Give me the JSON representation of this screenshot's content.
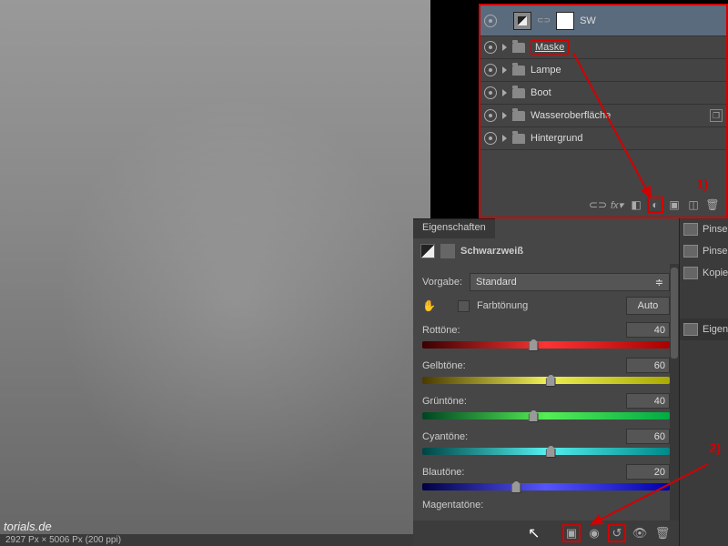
{
  "canvas": {
    "watermark": "torials.de",
    "status": "2927 Px × 5006 Px (200 ppi)"
  },
  "layers": {
    "items": [
      {
        "label": "SW",
        "type": "adjustment",
        "selected": true
      },
      {
        "label": "Maske",
        "type": "group",
        "highlighted": true
      },
      {
        "label": "Lampe",
        "type": "group"
      },
      {
        "label": "Boot",
        "type": "group"
      },
      {
        "label": "Wasseroberfläche",
        "type": "group"
      },
      {
        "label": "Hintergrund",
        "type": "group"
      }
    ],
    "callout": "1)"
  },
  "properties": {
    "tab": "Eigenschaften",
    "title": "Schwarzweiß",
    "preset_label": "Vorgabe:",
    "preset_value": "Standard",
    "tint_label": "Farbtönung",
    "auto_label": "Auto",
    "sliders": [
      {
        "label": "Rottöne:",
        "value": 40,
        "cls": "t-rot",
        "pos": 45
      },
      {
        "label": "Gelbtöne:",
        "value": 60,
        "cls": "t-gelb",
        "pos": 52
      },
      {
        "label": "Grüntöne:",
        "value": 40,
        "cls": "t-gruen",
        "pos": 45
      },
      {
        "label": "Cyantöne:",
        "value": 60,
        "cls": "t-cyan",
        "pos": 52
      },
      {
        "label": "Blautöne:",
        "value": 20,
        "cls": "t-blau",
        "pos": 38
      }
    ],
    "magenta_label": "Magentatöne:",
    "callout": "2)"
  },
  "rpanel": {
    "items": [
      "Pinselv",
      "Pinsel",
      "Kopie"
    ],
    "section": "Eigens"
  }
}
